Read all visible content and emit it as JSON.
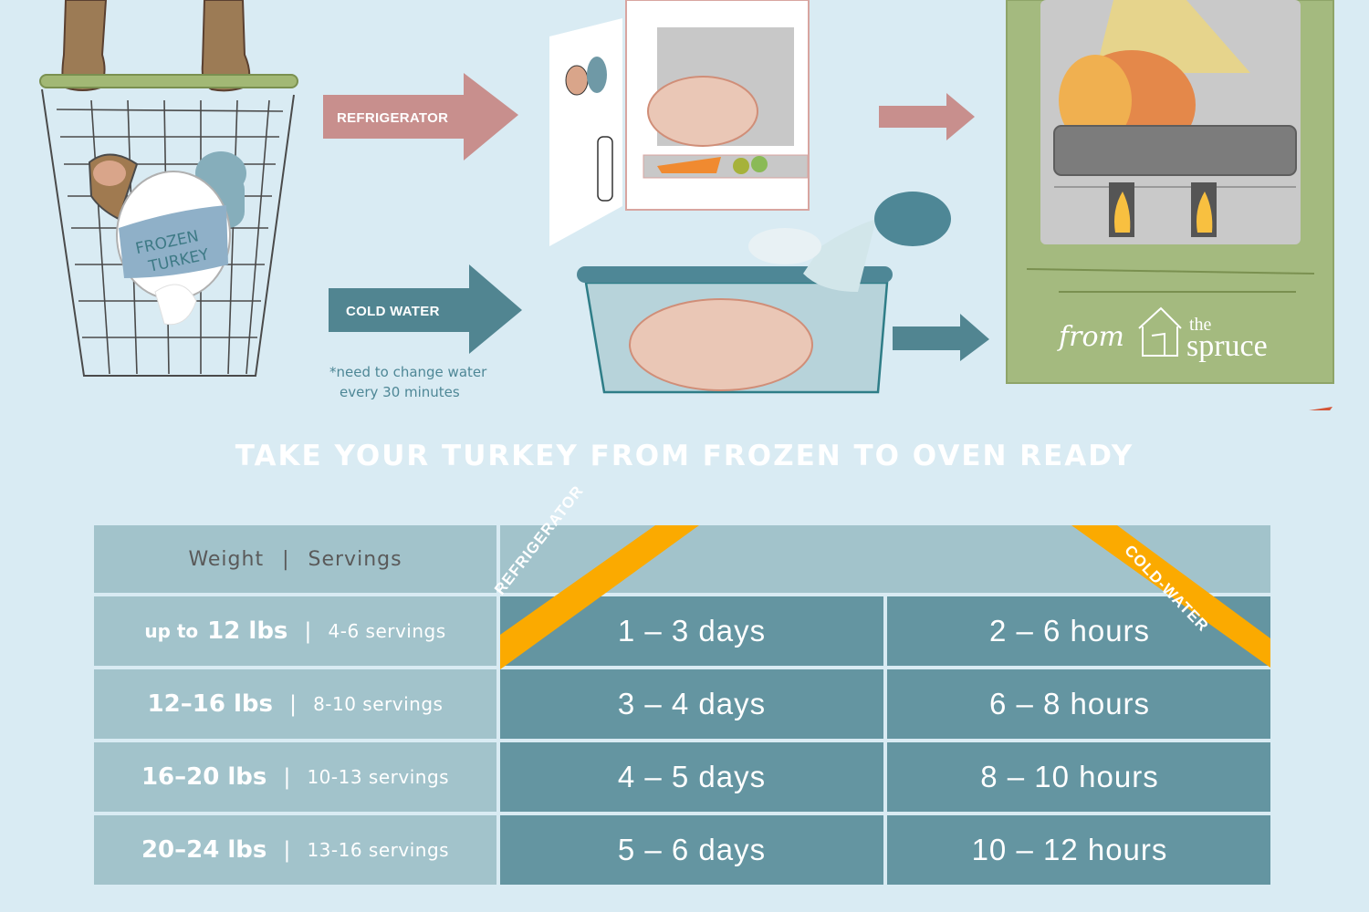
{
  "illustration": {
    "basket_label": "FROZEN TURKEY",
    "arrows": [
      {
        "label": "REFRIGERATOR",
        "color": "#c88f8d"
      },
      {
        "label": "COLD WATER",
        "color": "#518591"
      }
    ],
    "note": [
      "*need to change water",
      "every 30 minutes"
    ],
    "logo": {
      "prefix": "from",
      "brand_small": "the",
      "brand_large": "spruce"
    }
  },
  "banner": {
    "title": "TAKE YOUR TURKEY FROM FROZEN TO OVEN READY",
    "color": "#d95f43"
  },
  "table": {
    "header": {
      "weight": "Weight",
      "separator": "|",
      "servings": "Servings"
    },
    "method_ribbons": {
      "left": "REFRIGERATOR",
      "right": "COLD-WATER",
      "color": "#fbaa00"
    },
    "rows": [
      {
        "weight_prefix": "up to",
        "weight": "12 lbs",
        "servings": "4-6 servings",
        "refrigerator": "1 – 3 days",
        "cold_water": "2 – 6 hours"
      },
      {
        "weight_prefix": "",
        "weight": "12–16 lbs",
        "servings": "8-10 servings",
        "refrigerator": "3 – 4 days",
        "cold_water": "6 – 8 hours"
      },
      {
        "weight_prefix": "",
        "weight": "16–20 lbs",
        "servings": "10-13 servings",
        "refrigerator": "4 – 5 days",
        "cold_water": "8 – 10 hours"
      },
      {
        "weight_prefix": "",
        "weight": "20–24 lbs",
        "servings": "13-16 servings",
        "refrigerator": "5 – 6 days",
        "cold_water": "10 – 12 hours"
      }
    ]
  },
  "colors": {
    "background": "#d9ebf3",
    "table_light": "#a2c3cb",
    "table_dark": "#6495a1",
    "oven_green": "#a4ba7f"
  }
}
